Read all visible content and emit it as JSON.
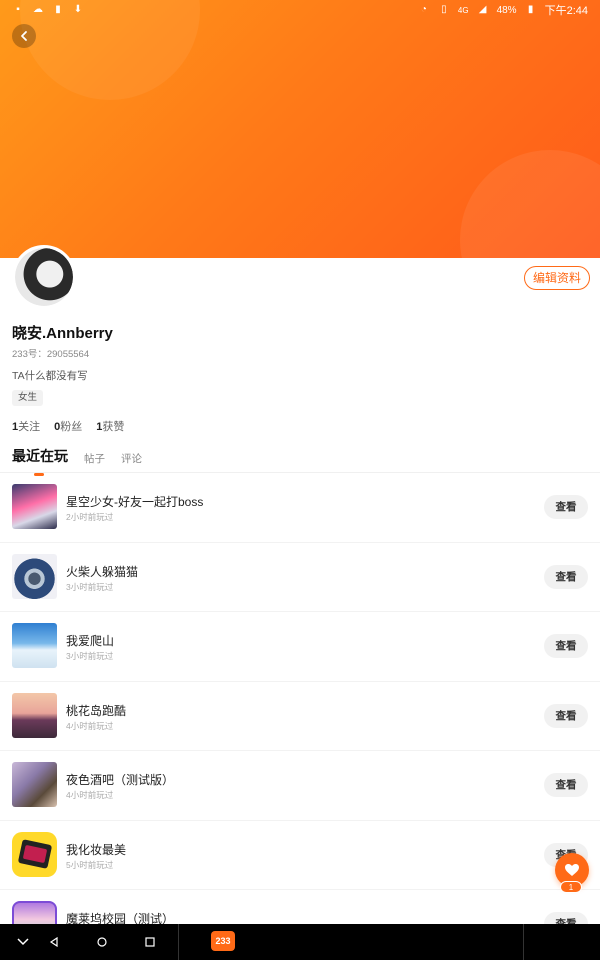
{
  "statusbar": {
    "battery": "48%",
    "time": "下午2:44",
    "network": "4G"
  },
  "header": {
    "accent_color": "#ff6a17"
  },
  "profile": {
    "edit_label": "编辑资料",
    "name": "晓安.Annberry",
    "uid": "233号：29055564",
    "bio": "TA什么都没有写",
    "gender": "女生",
    "stats": [
      {
        "num": "1",
        "label": "关注"
      },
      {
        "num": "0",
        "label": "粉丝"
      },
      {
        "num": "1",
        "label": "获赞"
      }
    ]
  },
  "tabs": [
    {
      "label": "最近在玩",
      "active": true
    },
    {
      "label": "帖子",
      "active": false
    },
    {
      "label": "评论",
      "active": false
    }
  ],
  "games": [
    {
      "title": "星空少女-好友一起打boss",
      "time": "2小时前玩过",
      "action": "查看",
      "icon": "anime-girl-icon"
    },
    {
      "title": "火柴人躲猫猫",
      "time": "3小时前玩过",
      "action": "查看",
      "icon": "temple-bell-icon"
    },
    {
      "title": "我爱爬山",
      "time": "3小时前玩过",
      "action": "查看",
      "icon": "mountain-icon"
    },
    {
      "title": "桃花岛跑酷",
      "time": "4小时前玩过",
      "action": "查看",
      "icon": "peach-tree-icon"
    },
    {
      "title": "夜色酒吧（测试版）",
      "time": "4小时前玩过",
      "action": "查看",
      "icon": "anime-couple-icon"
    },
    {
      "title": "我化妆最美",
      "time": "5小时前玩过",
      "action": "查看",
      "icon": "makeup-palette-icon"
    },
    {
      "title": "魔莱坞校园（测试）",
      "time": "",
      "action": "查看",
      "icon": "bunny-girl-icon"
    }
  ],
  "like": {
    "count": "1"
  },
  "taskbar": {
    "app_label": "233"
  }
}
